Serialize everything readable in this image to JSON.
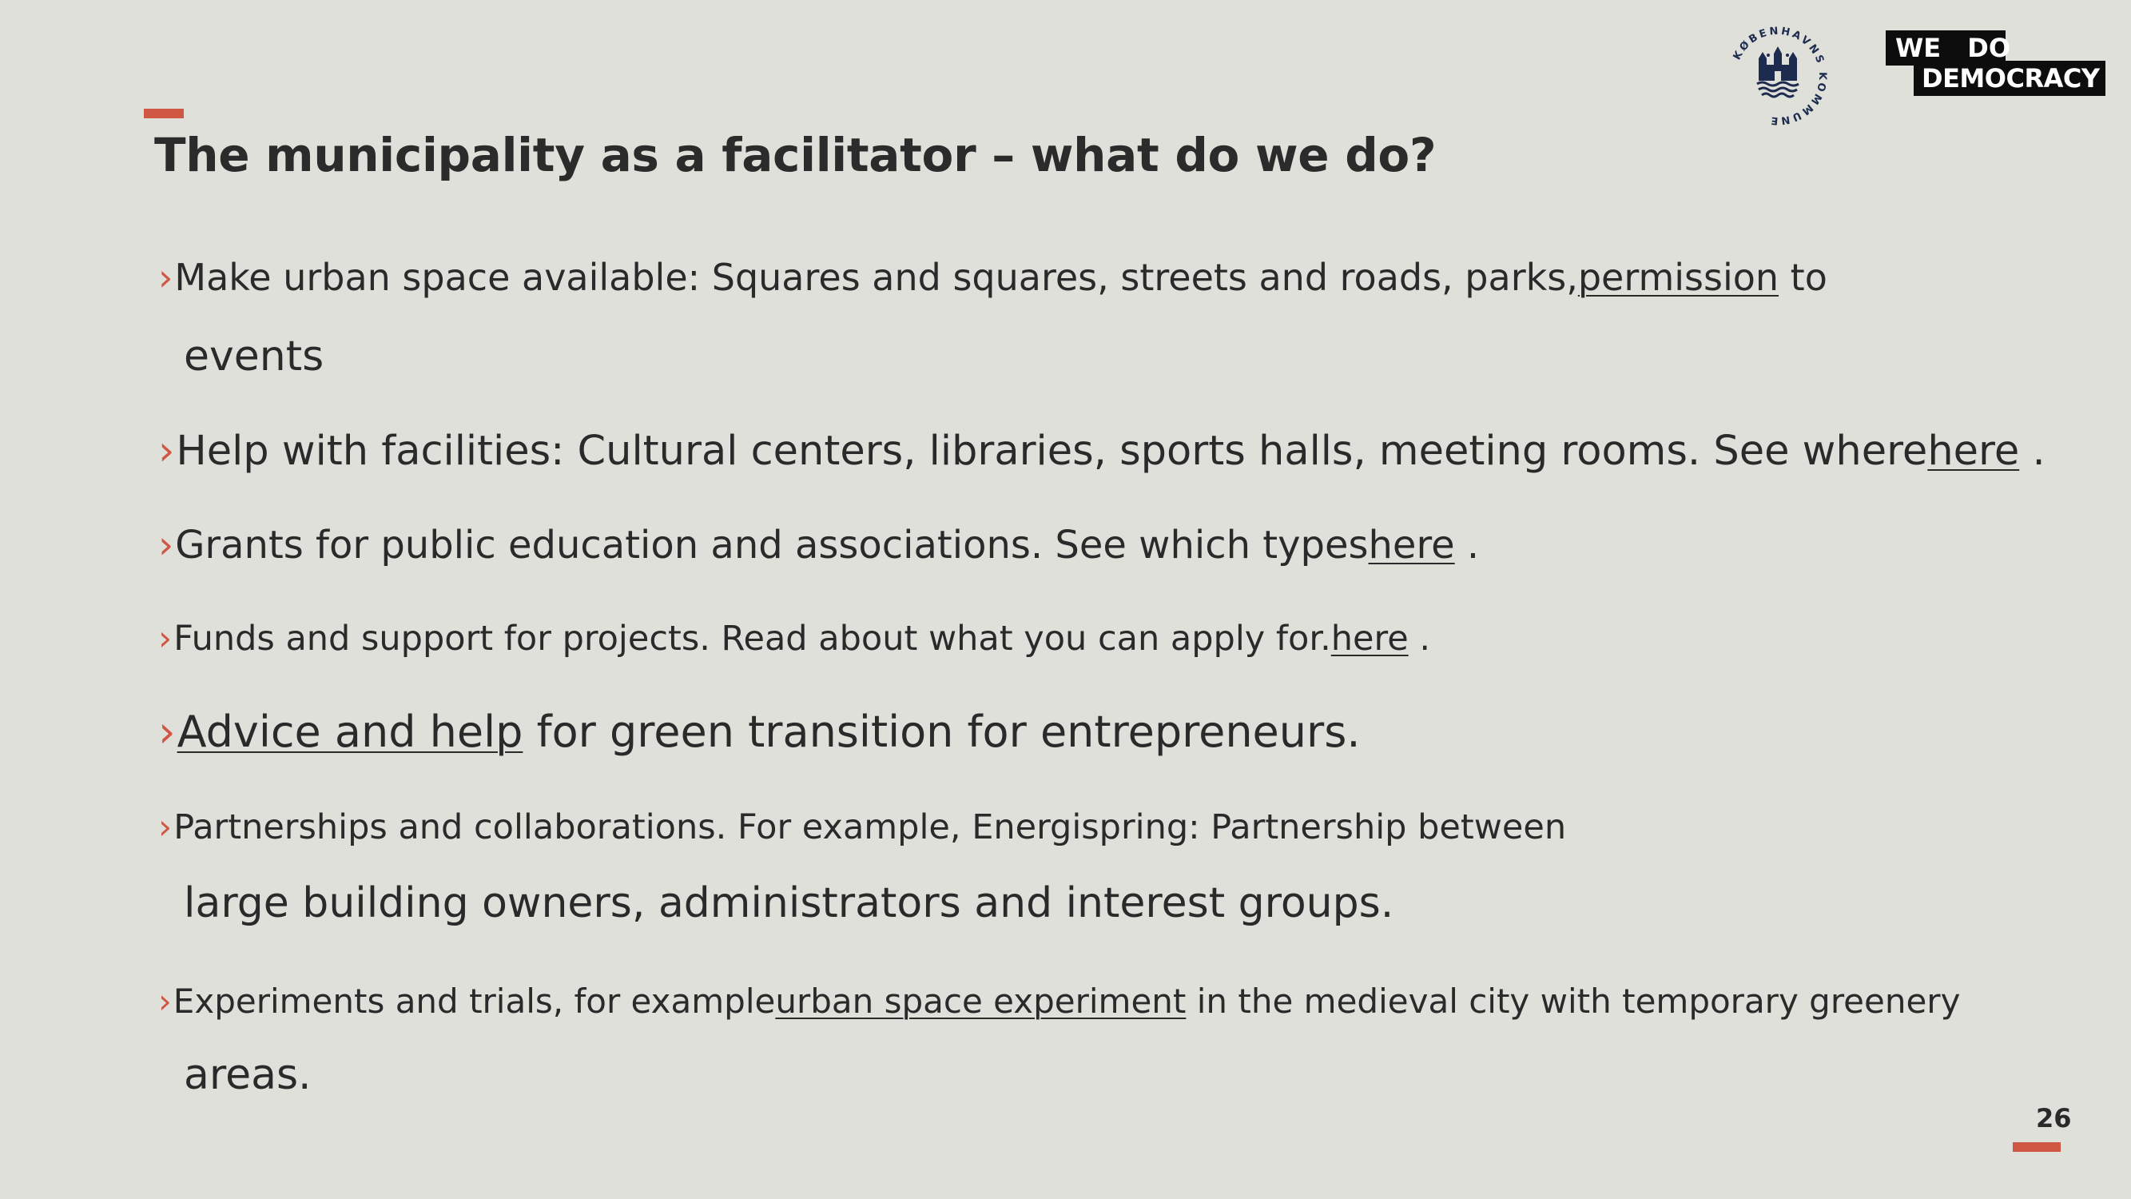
{
  "slide": {
    "title": "The municipality as a facilitator – what do we do?",
    "page_number": "26",
    "bullet_marker": "›"
  },
  "logos": {
    "kobenhavns_kommune": {
      "text": "KØBENHAVNS KOMMUNE",
      "icon": "copenhagen-coat-of-arms-icon"
    },
    "we_do_democracy": {
      "line1": "WE DO",
      "line2": "DEMOCRACY"
    }
  },
  "bullets": [
    {
      "pre": "Make urban space available: Squares and squares, streets and roads, parks,",
      "link": "permission",
      "post": " to",
      "continuation": "events"
    },
    {
      "pre": "Help with facilities: Cultural centers, libraries, sports halls, meeting rooms. See where",
      "link": "here",
      "post": " ."
    },
    {
      "pre": "Grants for public education and associations. See which types",
      "link": "here",
      "post": " ."
    },
    {
      "pre": "Funds and support for projects. Read about what you can apply for.",
      "link": "here",
      "post": " ."
    },
    {
      "pre": "",
      "link": "Advice and help",
      "post": " for green transition for entrepreneurs."
    },
    {
      "pre": "Partnerships and collaborations. For example, Energispring: Partnership between",
      "continuation": "large building owners, administrators and interest groups."
    },
    {
      "pre": "Experiments and trials, for example",
      "link": "urban space experiment",
      "post": " in the medieval city with temporary greenery",
      "continuation": "areas."
    }
  ],
  "colors": {
    "background": "#e0e0db",
    "accent": "#cf5744",
    "text": "#2a2a2a",
    "logo_navy": "#1d2b4f"
  }
}
